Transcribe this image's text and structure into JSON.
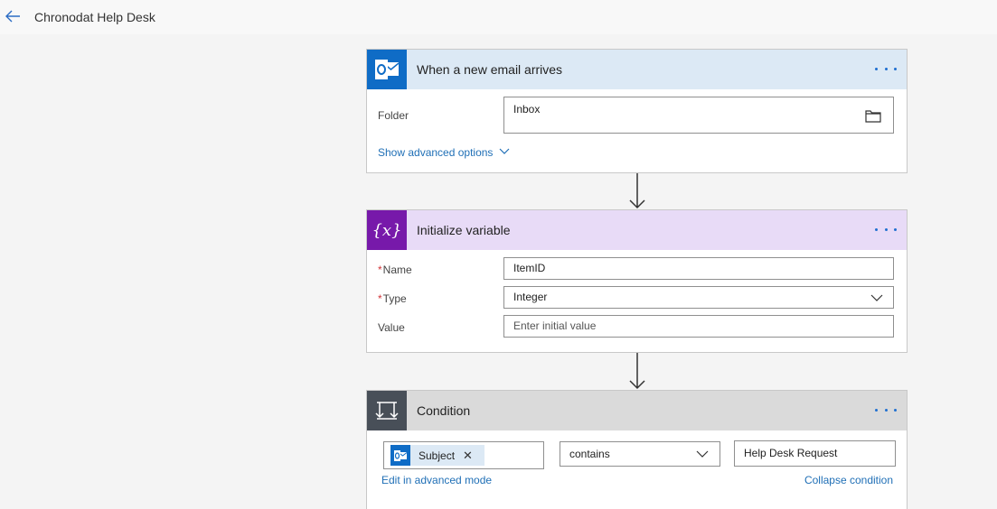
{
  "header": {
    "title": "Chronodat Help Desk"
  },
  "steps": {
    "trigger": {
      "title": "When a new email arrives",
      "icon": "outlook-icon",
      "color": "#dce9f5",
      "folder_label": "Folder",
      "folder_value": "Inbox",
      "advanced_link": "Show advanced options"
    },
    "variable": {
      "title": "Initialize variable",
      "icon": "variable-icon",
      "color": "#e8dbf7",
      "name_label": "Name",
      "name_value": "ItemID",
      "type_label": "Type",
      "type_value": "Integer",
      "value_label": "Value",
      "value_placeholder": "Enter initial value"
    },
    "condition": {
      "title": "Condition",
      "icon": "condition-icon",
      "color": "#dadada",
      "token_label": "Subject",
      "operator": "contains",
      "compare_value": "Help Desk Request",
      "edit_advanced_link": "Edit in advanced mode",
      "collapse_link": "Collapse condition"
    }
  },
  "required_marker": "*"
}
